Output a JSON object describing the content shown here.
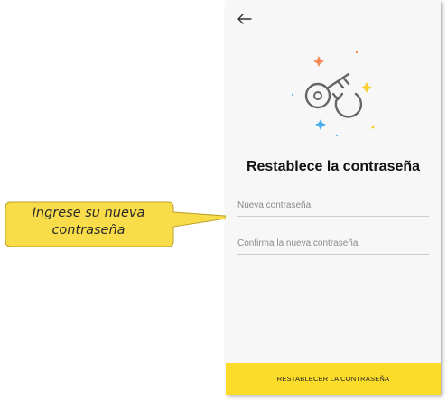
{
  "callout": {
    "line1": "Ingrese su nueva",
    "line2": "contraseña"
  },
  "screen": {
    "back_icon": "arrow-left-icon",
    "hero_icon": "key-reset-icon",
    "title": "Restablece la contraseña",
    "new_password_placeholder": "Nueva contraseña",
    "confirm_password_placeholder": "Confirma la nueva contraseña",
    "submit_label": "RESTABLECER LA CONTRASEÑA"
  },
  "colors": {
    "accent": "#fcdc2a",
    "callout_fill": "#f9dc4a",
    "background": "#f7f7f7"
  }
}
